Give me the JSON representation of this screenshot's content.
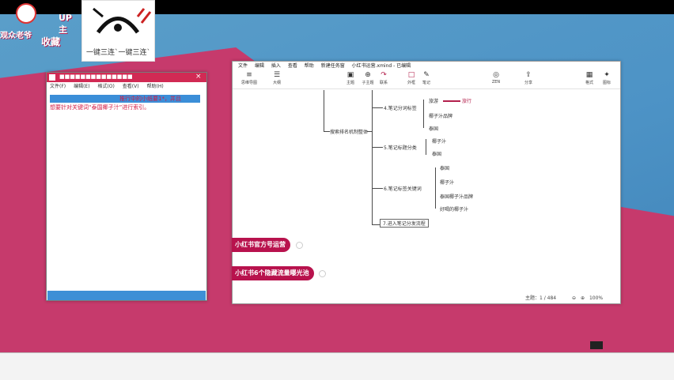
{
  "overlay": {
    "up_label": "UP主",
    "viewers_label": "观众老爷",
    "fav_label": "收藏",
    "card_caption": "一键三连`一键三连`"
  },
  "notepad": {
    "title": "■■■■■■■■■■■■■■",
    "menu": [
      "文件(F)",
      "编辑(E)",
      "格式(O)",
      "查看(V)",
      "帮助(H)"
    ],
    "line1": "推行中的小纸要1*，并且",
    "line2": "想要针对关键词“泰国椰子汁”进行索引。"
  },
  "xmind": {
    "menu": [
      "文件",
      "编辑",
      "插入",
      "查看",
      "帮助",
      "新建任务窗",
      "小红书运营.xmind - 已编辑"
    ],
    "toolbar_left": [
      {
        "icon": "≡",
        "label": "思维导图"
      },
      {
        "icon": "☰",
        "label": "大纲"
      }
    ],
    "toolbar_mid": [
      {
        "icon": "▣",
        "label": "主题"
      },
      {
        "icon": "⊕",
        "label": "子主题"
      },
      {
        "icon": "↷",
        "label": "联系"
      },
      {
        "icon": "□",
        "label": "外框"
      },
      {
        "icon": "✎",
        "label": "笔记"
      }
    ],
    "toolbar_right": [
      {
        "icon": "◎",
        "label": "ZEN"
      },
      {
        "icon": "⇪",
        "label": "分享"
      },
      {
        "icon": "▦",
        "label": "格式"
      },
      {
        "icon": "✦",
        "label": "图标"
      }
    ],
    "root_node": "搜索排名机制整体",
    "branches": [
      {
        "label": "4.笔记分词标签",
        "children": [
          "旅游",
          "椰子汁品牌",
          "泰国"
        ],
        "tag": "旅行"
      },
      {
        "label": "5.笔记标题分类",
        "children": [
          "椰子汁",
          "泰国"
        ]
      },
      {
        "label": "6.笔记标签关键词",
        "children": [
          "泰国",
          "椰子汁",
          "泰国椰子汁品牌",
          "好喝的椰子汁"
        ]
      },
      {
        "label": "7.进入笔记分发流程",
        "children": []
      }
    ],
    "status": "主题：1 / 484",
    "zoom": "100%"
  },
  "pills": [
    {
      "label": "小红书官方号运营"
    },
    {
      "label": "小红书6个隐藏流量曝光池"
    }
  ],
  "colors": {
    "accent": "#b8124d",
    "wallpaper_blue": "#4d93c6",
    "wallpaper_pink": "#c63a6c"
  }
}
